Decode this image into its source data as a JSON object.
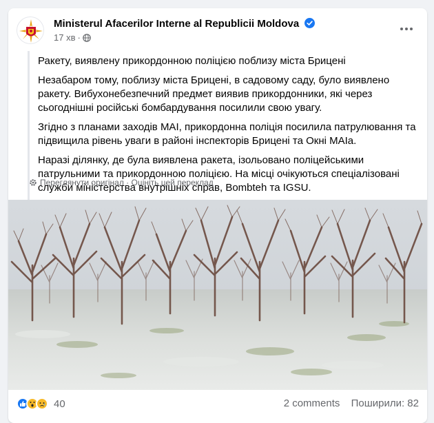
{
  "post": {
    "author": "Ministerul Afacerilor Interne al Republicii Moldova",
    "time": "17 хв",
    "dot": "·",
    "paragraphs": [
      "Ракету, виявлену прикордонною поліцією поблизу міста Бриценi",
      "Незабаром тому, поблизу міста Бриценi, в садовому саду, було виявлено ракету. Вибухонебезпечний предмет виявив прикордонники, які через сьогоднішні російські бомбардування посилили свою увагу.",
      "Згідно з планами заходів МАІ, прикордонна поліція посилила патрулювання та підвищила рівень уваги в районі інспекторів Бриценi та Окні МАIа.",
      "Наразі ділянку, де була виявлена ракета, ізольовано поліцейськими патрульними та прикордонною поліцією. На місці очікуються спеціалізовані служби міністерства внутрішніх справ, Bombteh та IGSU."
    ],
    "see_original": "Переглянути оригінал",
    "translate_sep": "·",
    "rate_translation": "Оцініть цей переклад",
    "reaction_count": "40",
    "comments": "2 comments",
    "shares": "Поширили: 82"
  },
  "icons": {
    "verified": "verified-badge-icon",
    "globe": "globe-icon",
    "more": "more-options-icon",
    "gear": "gear-icon",
    "like": "like-reaction-icon",
    "wow": "wow-reaction-icon",
    "sad": "sad-reaction-icon"
  },
  "colors": {
    "accent": "#1877f2",
    "reaction_yellow": "#f7b928",
    "text_secondary": "#65676b"
  }
}
